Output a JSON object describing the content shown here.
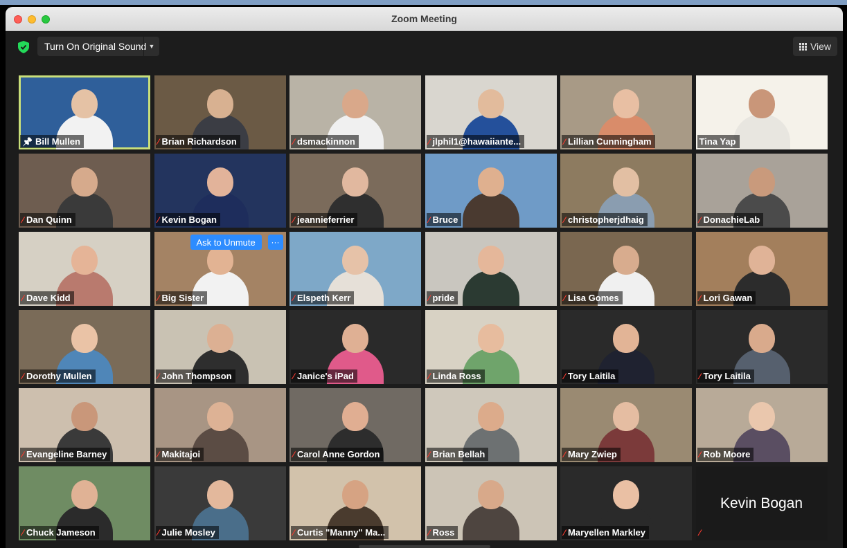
{
  "window": {
    "title": "Zoom Meeting"
  },
  "toolbar": {
    "original_sound_label": "Turn On Original Sound",
    "view_label": "View"
  },
  "tiles": [
    {
      "name": "Bill Mullen",
      "bg": "#2f5f9a",
      "head": "#e5c2a5",
      "shirt": "#f2f2f2",
      "muted": false,
      "pinned": true,
      "active": true
    },
    {
      "name": "Brian Richardson",
      "bg": "#6b5a45",
      "head": "#d8b191",
      "shirt": "#3b3d44",
      "muted": true
    },
    {
      "name": "dsmackinnon",
      "bg": "#b9b3a6",
      "head": "#d9a88a",
      "shirt": "#f0f0f0",
      "muted": true
    },
    {
      "name": "jlphil1@hawaiiante...",
      "bg": "#d9d6cf",
      "head": "#e2bb9c",
      "shirt": "#24509b",
      "muted": true
    },
    {
      "name": "Lillian Cunningham",
      "bg": "#a89a86",
      "head": "#e8bfa3",
      "shirt": "#d98c6a",
      "muted": true
    },
    {
      "name": "Tina Yap",
      "bg": "#f5f2ea",
      "head": "#c99679",
      "shirt": "#e8e6e0",
      "muted": false
    },
    {
      "name": "Dan Quinn",
      "bg": "#6e5d50",
      "head": "#d6aa8c",
      "shirt": "#3a3a3a",
      "muted": true
    },
    {
      "name": "Kevin Bogan",
      "bg": "#23345e",
      "head": "#e2b39a",
      "shirt": "#1e2d5c",
      "muted": true
    },
    {
      "name": "jeannieferrier",
      "bg": "#7b6b5b",
      "head": "#e1b89f",
      "shirt": "#2f2f2f",
      "muted": true
    },
    {
      "name": "Bruce",
      "bg": "#6f9bc7",
      "head": "#dfb08f",
      "shirt": "#4a3a30",
      "muted": true
    },
    {
      "name": "christopherjdhaig",
      "bg": "#8d7b60",
      "head": "#e2bfa3",
      "shirt": "#8a9db0",
      "muted": true
    },
    {
      "name": "DonachieLab",
      "bg": "#a9a299",
      "head": "#c99a7c",
      "shirt": "#4b4b4b",
      "muted": true
    },
    {
      "name": "Dave Kidd",
      "bg": "#d6d0c4",
      "head": "#e5b497",
      "shirt": "#b97a6e",
      "muted": true
    },
    {
      "name": "Big Sister",
      "bg": "#a48364",
      "head": "#e2b393",
      "shirt": "#f2f2f2",
      "muted": true
    },
    {
      "name": "Elspeth Kerr",
      "bg": "#7ea8c8",
      "head": "#e6c2a8",
      "shirt": "#e6e0d8",
      "muted": true
    },
    {
      "name": "pride",
      "bg": "#c9c6bf",
      "head": "#e5b79a",
      "shirt": "#2b3a32",
      "muted": true
    },
    {
      "name": "Lisa Gomes",
      "bg": "#7a6750",
      "head": "#d8ac8e",
      "shirt": "#f0f0f0",
      "muted": true
    },
    {
      "name": "Lori Gawan",
      "bg": "#a37f5c",
      "head": "#e0b397",
      "shirt": "#2c2c2c",
      "muted": true
    },
    {
      "name": "Dorothy Mullen",
      "bg": "#7a6b58",
      "head": "#eac3a6",
      "shirt": "#4f86b8",
      "muted": true
    },
    {
      "name": "John Thompson",
      "bg": "#c9c2b3",
      "head": "#dcb093",
      "shirt": "#2e2e2e",
      "muted": true
    },
    {
      "name": "Janice's iPad",
      "bg": "#2a2a2a",
      "head": "#dfb094",
      "shirt": "#e05a8a",
      "muted": true
    },
    {
      "name": "Linda Ross",
      "bg": "#d8d2c4",
      "head": "#e7bc9e",
      "shirt": "#6fa46b",
      "muted": true
    },
    {
      "name": "Tory Laitila",
      "bg": "#2a2a2a",
      "head": "#e2b496",
      "shirt": "#1f2230",
      "muted": true
    },
    {
      "name": "Tory Laitila",
      "bg": "#2a2a2a",
      "head": "#d9aa8c",
      "shirt": "#56606e",
      "muted": true
    },
    {
      "name": "Evangeline Barney",
      "bg": "#cdbfae",
      "head": "#c9977a",
      "shirt": "#3a3a3a",
      "muted": true
    },
    {
      "name": "Makitajoi",
      "bg": "#a89584",
      "head": "#ddb295",
      "shirt": "#5b4c44",
      "muted": true
    },
    {
      "name": "Carol Anne Gordon",
      "bg": "#706a63",
      "head": "#e0ae92",
      "shirt": "#2d2d2d",
      "muted": true
    },
    {
      "name": "Brian Bellah",
      "bg": "#cfc8bb",
      "head": "#dcab8b",
      "shirt": "#6d7172",
      "muted": true
    },
    {
      "name": "Mary Zwiep",
      "bg": "#9a8a72",
      "head": "#e5bda2",
      "shirt": "#7b3a3a",
      "muted": true
    },
    {
      "name": "Rob Moore",
      "bg": "#b8aa98",
      "head": "#eac7ad",
      "shirt": "#5a4e62",
      "muted": true
    },
    {
      "name": "Chuck Jameson",
      "bg": "#6f8c63",
      "head": "#e0b295",
      "shirt": "#2b2b2b",
      "muted": true
    },
    {
      "name": "Julie Mosley",
      "bg": "#3a3a3a",
      "head": "#e3b89c",
      "shirt": "#4a6e8a",
      "muted": true
    },
    {
      "name": "Curtis \"Manny\" Ma...",
      "bg": "#d2c2ab",
      "head": "#d6a383",
      "shirt": "#4a3b2e",
      "muted": true
    },
    {
      "name": "Ross",
      "bg": "#ccc4b6",
      "head": "#d8a98a",
      "shirt": "#4e4540",
      "muted": true
    },
    {
      "name": "Maryellen Markley",
      "bg": "#2a2a2a",
      "head": "#eac0a4",
      "shirt": "#2a2a2a",
      "muted": true
    },
    {
      "name": "",
      "bg": "#1a1a1a",
      "muted": true,
      "blank": true,
      "big_name": "Kevin Bogan"
    }
  ],
  "overlay": {
    "ask_to_unmute_label": "Ask to Unmute",
    "more_label": "···"
  },
  "icons": {
    "muted": "mic-off-icon",
    "pinned": "pin-icon",
    "security": "shield-icon",
    "view": "grid-view-icon"
  },
  "colors": {
    "active_speaker_border": "#c9df7a",
    "unmute_button": "#2d8cff",
    "muted_mic": "#ff3b30"
  }
}
